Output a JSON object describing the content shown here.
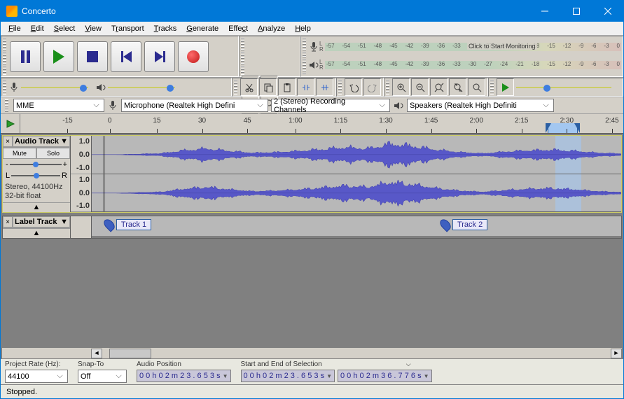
{
  "window": {
    "title": "Concerto"
  },
  "menu": [
    "File",
    "Edit",
    "Select",
    "View",
    "Transport",
    "Tracks",
    "Generate",
    "Effect",
    "Analyze",
    "Help"
  ],
  "meters": {
    "rec_msg": "Click to Start Monitoring",
    "ticks": [
      "-57",
      "-54",
      "-51",
      "-48",
      "-45",
      "-42",
      "-39",
      "-36",
      "-33",
      "-30",
      "-27",
      "-24",
      "-21",
      "-18",
      "-15",
      "-12",
      "-9",
      "-6",
      "-3",
      "0"
    ]
  },
  "device": {
    "host": "MME",
    "input": "Microphone (Realtek High Defini",
    "channels": "2 (Stereo) Recording Channels",
    "output": "Speakers (Realtek High Definiti"
  },
  "timeline": {
    "labels": [
      "-15",
      "0",
      "15",
      "30",
      "45",
      "1:00",
      "1:15",
      "1:30",
      "1:45",
      "2:00",
      "2:15",
      "2:30",
      "2:45"
    ],
    "positions": [
      7,
      14.5,
      22,
      29.5,
      37,
      44.5,
      52,
      59.5,
      67,
      74.5,
      82,
      89.5,
      97
    ]
  },
  "audio_track": {
    "name": "Audio Track",
    "mute": "Mute",
    "solo": "Solo",
    "info1": "Stereo, 44100Hz",
    "info2": "32-bit float",
    "vruler": [
      "1.0",
      "0.0",
      "-1.0"
    ]
  },
  "label_track": {
    "name": "Label Track",
    "labels": [
      {
        "text": "Track 1",
        "pos": 18
      },
      {
        "text": "Track 2",
        "pos": 68.5
      }
    ]
  },
  "selection": {
    "rate_label": "Project Rate (Hz):",
    "rate_value": "44100",
    "snap_label": "Snap-To",
    "snap_value": "Off",
    "audio_pos_label": "Audio Position",
    "audio_pos": "0 0 h 0 2 m 2 3 . 6 5 3 s",
    "range_label": "Start and End of Selection",
    "start": "0 0 h 0 2 m 2 3 . 6 5 3 s",
    "end": "0 0 h 0 2 m 3 6 . 7 7 6 s"
  },
  "status": "Stopped."
}
